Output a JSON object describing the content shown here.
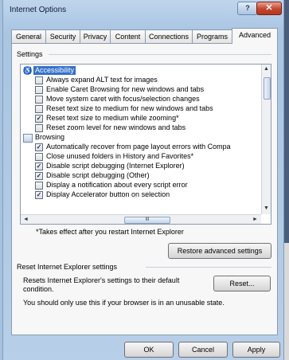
{
  "window": {
    "title": "Internet Options",
    "help_label": "?",
    "close_label": "✕"
  },
  "tabs": [
    {
      "label": "General"
    },
    {
      "label": "Security"
    },
    {
      "label": "Privacy"
    },
    {
      "label": "Content"
    },
    {
      "label": "Connections"
    },
    {
      "label": "Programs"
    },
    {
      "label": "Advanced",
      "active": true
    }
  ],
  "settings": {
    "label": "Settings",
    "items": [
      {
        "type": "category",
        "icon": "accessibility-icon",
        "label": "Accessibility",
        "selected": true
      },
      {
        "type": "option",
        "label": "Always expand ALT text for images",
        "checked": false
      },
      {
        "type": "option",
        "label": "Enable Caret Browsing for new windows and tabs",
        "checked": false
      },
      {
        "type": "option",
        "label": "Move system caret with focus/selection changes",
        "checked": false
      },
      {
        "type": "option",
        "label": "Reset text size to medium for new windows and tabs",
        "checked": false
      },
      {
        "type": "option",
        "label": "Reset text size to medium while zooming*",
        "checked": true
      },
      {
        "type": "option",
        "label": "Reset zoom level for new windows and tabs",
        "checked": false
      },
      {
        "type": "category",
        "icon": "browsing-icon",
        "label": "Browsing",
        "selected": false
      },
      {
        "type": "option",
        "label": "Automatically recover from page layout errors with Compa",
        "checked": true
      },
      {
        "type": "option",
        "label": "Close unused folders in History and Favorites*",
        "checked": false
      },
      {
        "type": "option",
        "label": "Disable script debugging (Internet Explorer)",
        "checked": true
      },
      {
        "type": "option",
        "label": "Disable script debugging (Other)",
        "checked": true
      },
      {
        "type": "option",
        "label": "Display a notification about every script error",
        "checked": false
      },
      {
        "type": "option",
        "label": "Display Accelerator button on selection",
        "checked": true
      }
    ],
    "check_glyph": "✓",
    "scroll": {
      "up": "▲",
      "down": "▼",
      "left": "◄",
      "right": "►",
      "thumb_grip": "III"
    },
    "restart_note": "*Takes effect after you restart Internet Explorer",
    "restore_button": "Restore advanced settings"
  },
  "reset": {
    "label": "Reset Internet Explorer settings",
    "description": "Resets Internet Explorer's settings to their default condition.",
    "button": "Reset...",
    "warning": "You should only use this if your browser is in an unusable state."
  },
  "footer": {
    "ok": "OK",
    "cancel": "Cancel",
    "apply": "Apply"
  }
}
